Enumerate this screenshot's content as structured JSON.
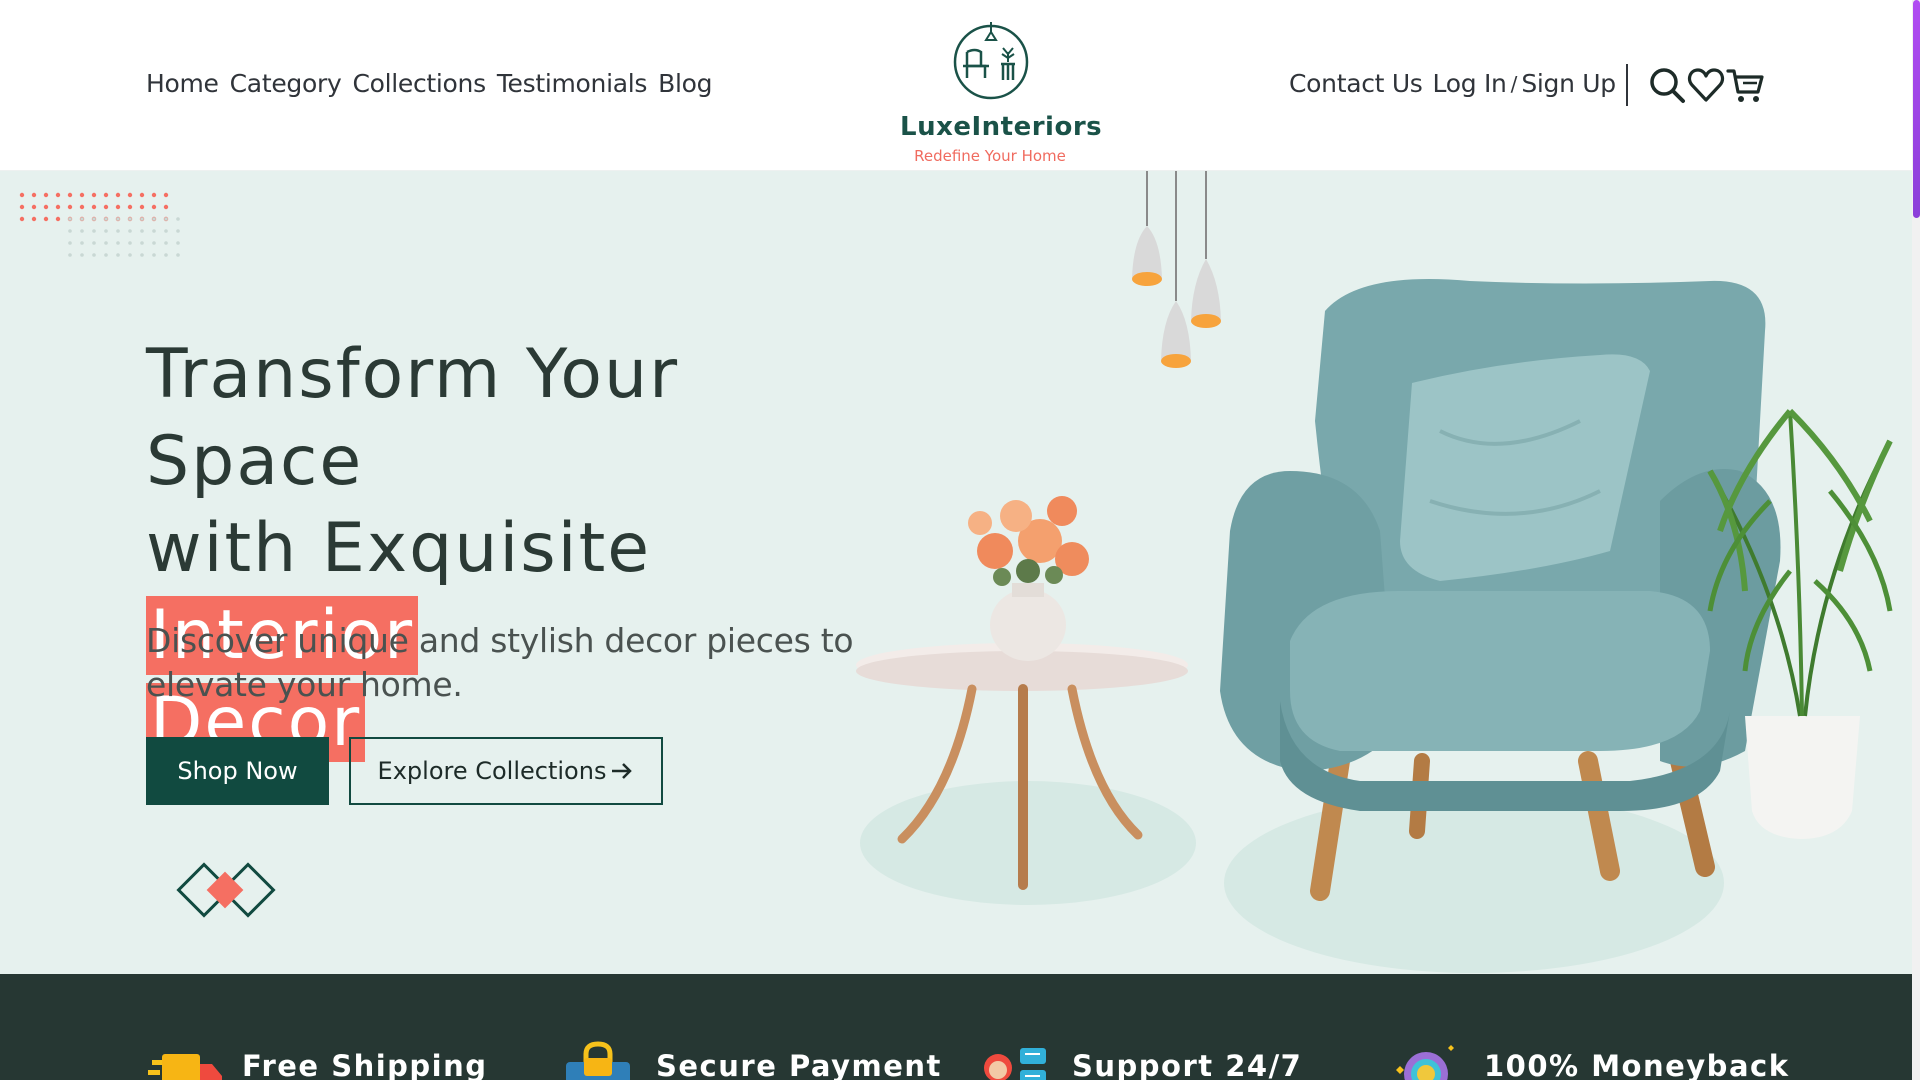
{
  "brand": {
    "name": "LuxeInteriors",
    "tagline": "Redefine Your Home",
    "primary_color": "#114a40",
    "accent_color": "#f56f62"
  },
  "nav": {
    "left": [
      "Home",
      "Category",
      "Collections",
      "Testimonials",
      "Blog"
    ],
    "contact": "Contact Us",
    "login": "Log In",
    "separator": "/",
    "signup": "Sign Up",
    "icons": [
      "search-icon",
      "heart-icon",
      "cart-icon"
    ]
  },
  "hero": {
    "headline_line1": "Transform Your Space",
    "headline_line2": "with Exquisite",
    "headline_highlight1": "Interior",
    "headline_highlight2": "Decor",
    "subheading": "Discover unique and stylish decor pieces to elevate your home.",
    "primary_cta": "Shop Now",
    "secondary_cta": "Explore Collections",
    "secondary_cta_icon": "arrow-right-icon",
    "background_color": "#e6f1ee"
  },
  "features": [
    {
      "label": "Free Shipping",
      "icon": "delivery-truck-icon"
    },
    {
      "label": "Secure Payment",
      "icon": "shopping-bag-lock-icon"
    },
    {
      "label": "Support 24/7",
      "icon": "support-agent-icon"
    },
    {
      "label": "100% Moneyback",
      "icon": "money-badge-icon"
    }
  ]
}
